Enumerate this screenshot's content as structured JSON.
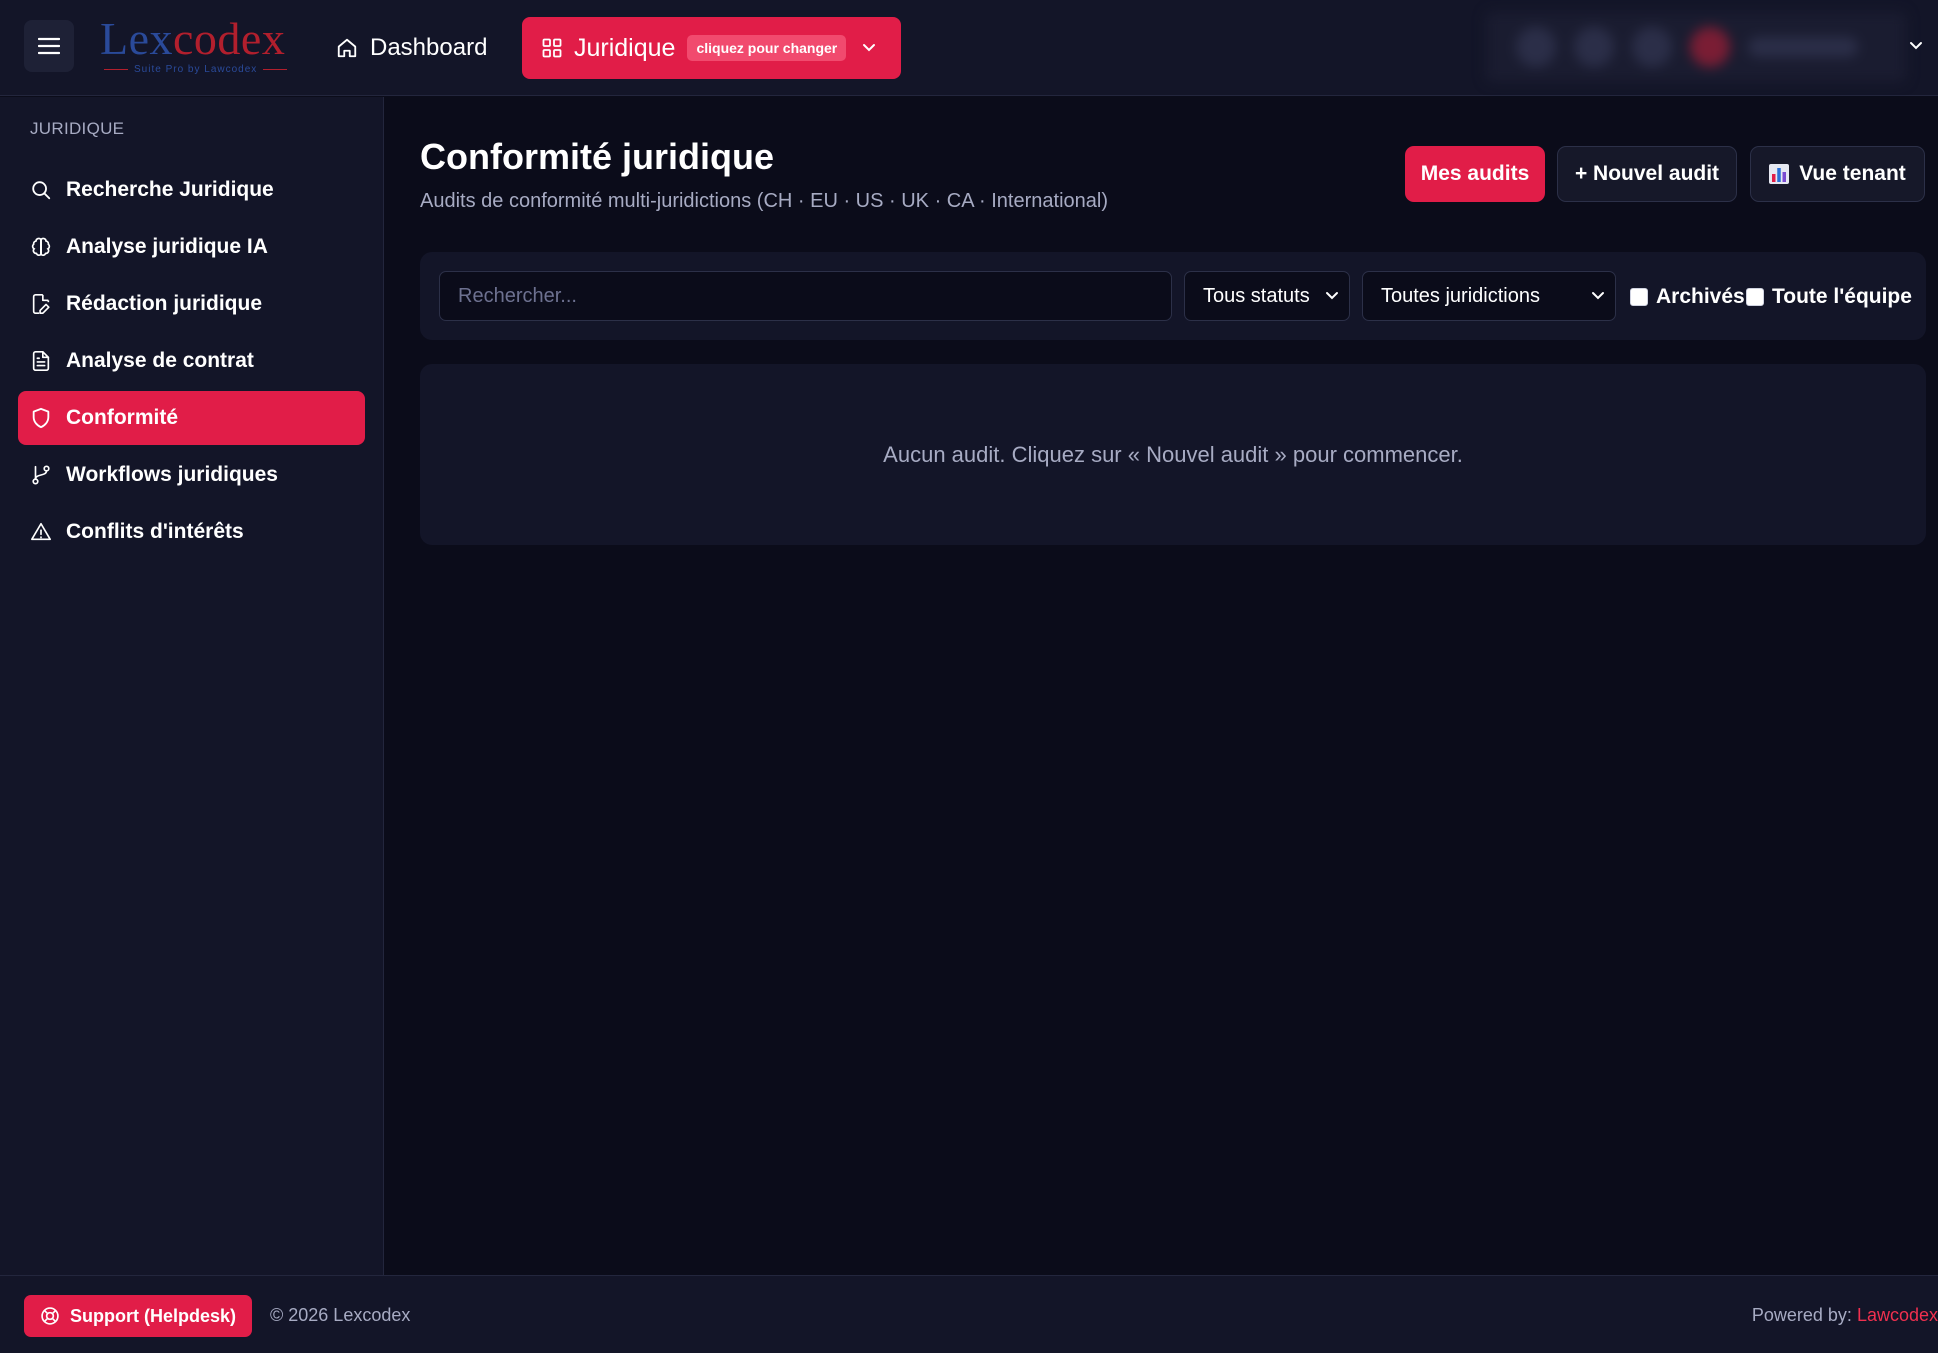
{
  "colors": {
    "accent": "#e11d48",
    "background": "#0b0c1a",
    "surface": "#131528",
    "muted_text": "#a7abc3",
    "logo_blue": "#2a4a9a",
    "logo_red": "#b21f2d"
  },
  "header": {
    "menu_icon": "hamburger-icon",
    "logo": {
      "part1": "Lex",
      "part2": "codex",
      "tagline": "Suite Pro by Lawcodex"
    },
    "dashboard": {
      "label": "Dashboard",
      "icon": "home-icon"
    },
    "module_switch": {
      "label": "Juridique",
      "hint": "cliquez pour changer",
      "icon": "grid-icon"
    }
  },
  "sidebar": {
    "section_title": "JURIDIQUE",
    "items": [
      {
        "label": "Recherche Juridique",
        "icon": "search-icon",
        "active": false
      },
      {
        "label": "Analyse juridique IA",
        "icon": "brain-icon",
        "active": false
      },
      {
        "label": "Rédaction juridique",
        "icon": "file-pen-icon",
        "active": false
      },
      {
        "label": "Analyse de contrat",
        "icon": "file-text-icon",
        "active": false
      },
      {
        "label": "Conformité",
        "icon": "shield-icon",
        "active": true
      },
      {
        "label": "Workflows juridiques",
        "icon": "git-branch-icon",
        "active": false
      },
      {
        "label": "Conflits d'intérêts",
        "icon": "warning-icon",
        "active": false
      }
    ]
  },
  "main": {
    "title": "Conformité juridique",
    "subtitle": "Audits de conformité multi-juridictions (CH · EU · US · UK · CA · International)",
    "buttons": {
      "my_audits": "Mes audits",
      "new_audit": "+ Nouvel audit",
      "tenant_view": "Vue tenant",
      "tenant_icon": "bar-chart-icon"
    },
    "filters": {
      "search_placeholder": "Rechercher...",
      "search_value": "",
      "status_selected": "Tous statuts",
      "jurisdiction_selected": "Toutes juridictions",
      "archived_label": "Archivés",
      "archived_checked": false,
      "team_label": "Toute l'équipe",
      "team_checked": false
    },
    "empty_message": "Aucun audit. Cliquez sur « Nouvel audit » pour commencer."
  },
  "footer": {
    "support_label": "Support (Helpdesk)",
    "support_icon": "lifebuoy-icon",
    "copyright": "© 2026 Lexcodex",
    "powered_prefix": "Powered by:",
    "powered_brand": "Lawcodex"
  }
}
